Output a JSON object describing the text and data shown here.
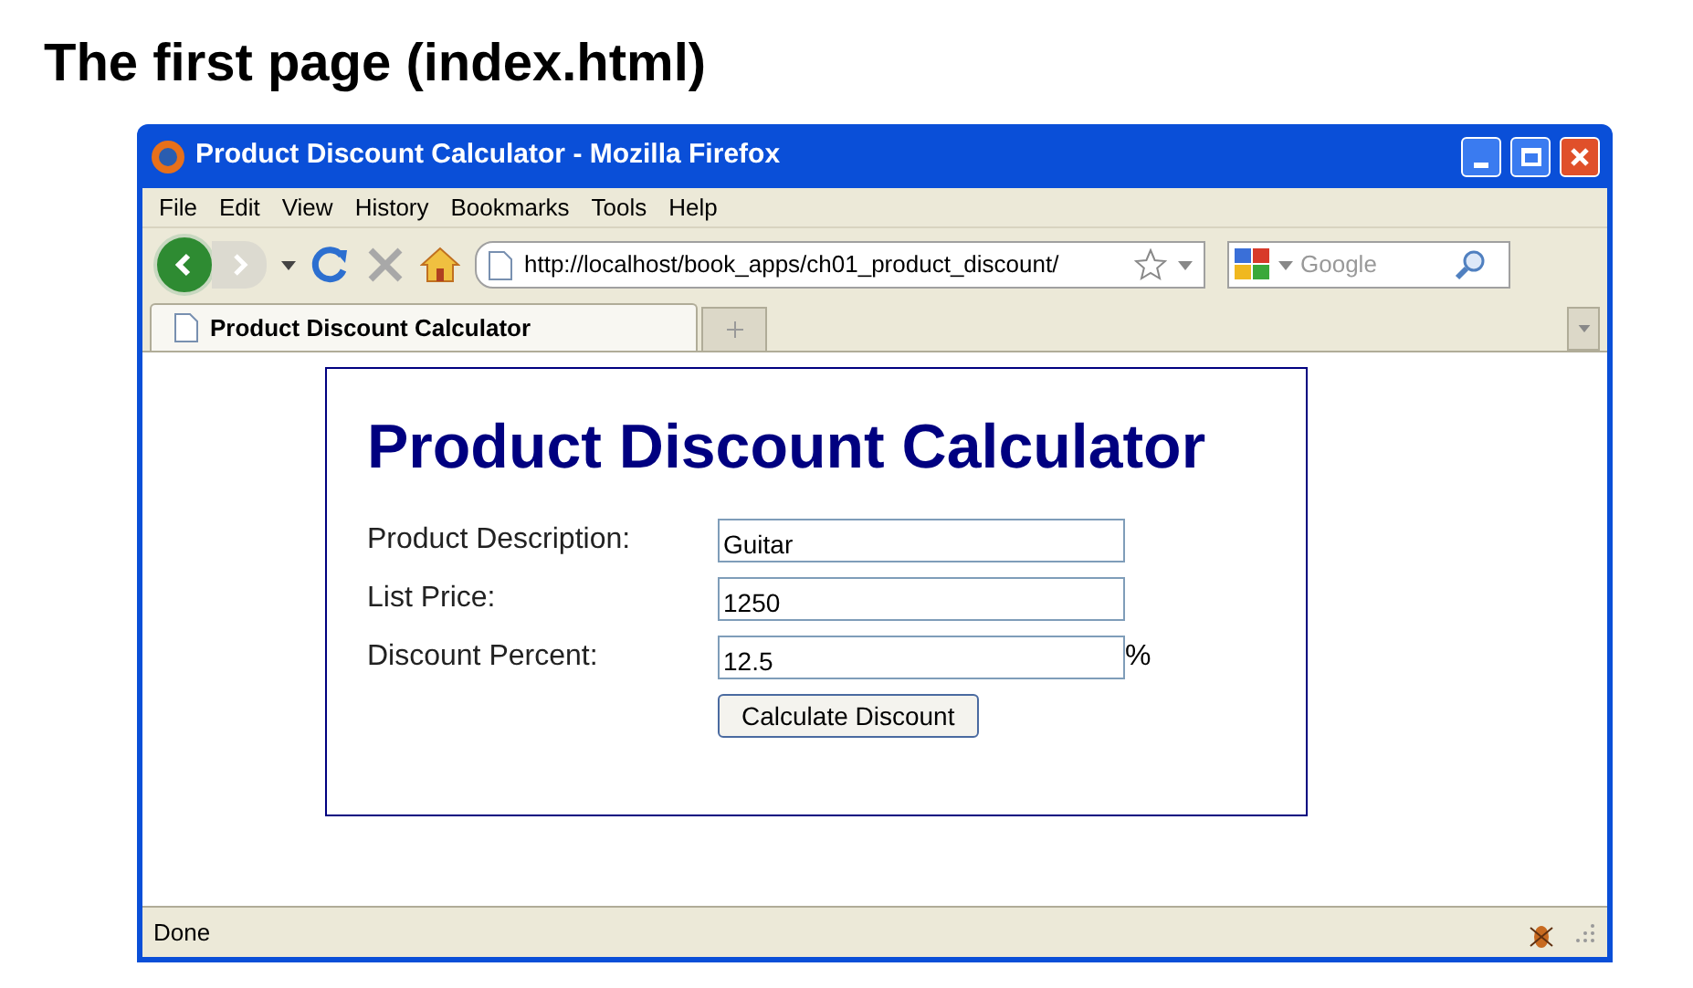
{
  "slide_title": "The first page (index.html)",
  "window": {
    "title": "Product Discount Calculator - Mozilla Firefox"
  },
  "menu": [
    "File",
    "Edit",
    "View",
    "History",
    "Bookmarks",
    "Tools",
    "Help"
  ],
  "address_bar": {
    "value": "http://localhost/book_apps/ch01_product_discount/"
  },
  "search": {
    "placeholder": "Google"
  },
  "tabs": [
    {
      "label": "Product Discount Calculator",
      "selected": true
    }
  ],
  "page": {
    "heading": "Product Discount Calculator",
    "fields": [
      {
        "label": "Product Description:",
        "value": "Guitar"
      },
      {
        "label": "List Price:",
        "value": "1250"
      },
      {
        "label": "Discount Percent:",
        "value": "12.5",
        "suffix": "%"
      }
    ],
    "button": "Calculate Discount"
  },
  "status_bar": {
    "text": "Done"
  }
}
